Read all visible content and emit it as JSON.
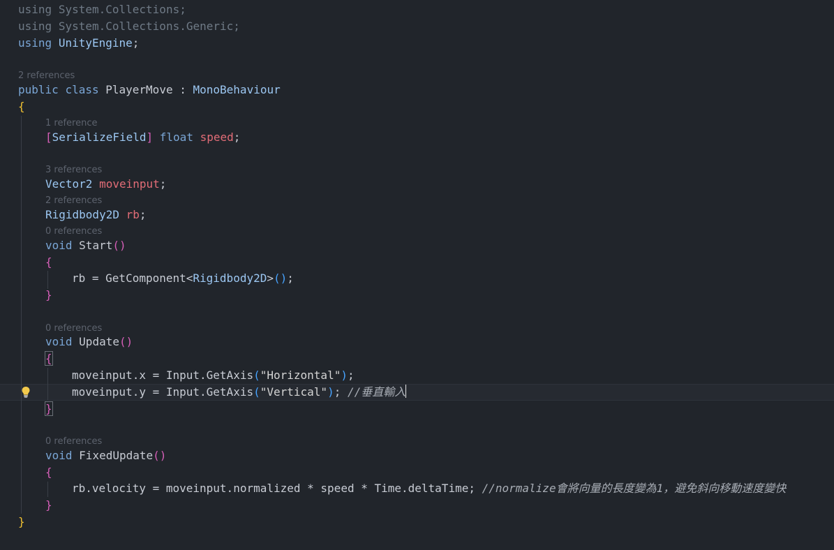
{
  "editor": {
    "usings": [
      {
        "kw": "using",
        "ns": "System.Collections",
        "end": ";"
      },
      {
        "kw": "using",
        "ns": "System.Collections.Generic",
        "end": ";"
      },
      {
        "kw": "using",
        "ns": "UnityEngine",
        "end": ";"
      }
    ],
    "class_refs": "2 references",
    "class_decl": {
      "mod": "public",
      "kw": "class",
      "name": "PlayerMove",
      "sep": ":",
      "base": "MonoBehaviour"
    },
    "open_brace": "{",
    "close_brace": "}",
    "speed": {
      "refs": "1 reference",
      "attr_open": "[",
      "attr": "SerializeField",
      "attr_close": "]",
      "type": "float",
      "name": "speed",
      "end": ";"
    },
    "moveinput_decl": {
      "refs": "3 references",
      "type": "Vector2",
      "name": "moveinput",
      "end": ";"
    },
    "rb_decl": {
      "refs": "2 references",
      "type": "Rigidbody2D",
      "name": "rb",
      "end": ";"
    },
    "start": {
      "refs": "0 references",
      "kw": "void",
      "name": "Start",
      "parens": "()",
      "open": "{",
      "close": "}",
      "body": {
        "lhs": "rb = GetComponent<",
        "generic": "Rigidbody2D",
        "rhs": ">",
        "call": "()",
        "end": ";"
      }
    },
    "update": {
      "refs": "0 references",
      "kw": "void",
      "name": "Update",
      "parens": "()",
      "open": "{",
      "close": "}",
      "line1": {
        "lhs": "moveinput.x = Input.GetAxis",
        "po": "(",
        "str": "\"Horizontal\"",
        "pc": ")",
        "end": ";"
      },
      "line2": {
        "lhs": "moveinput.y = Input.GetAxis",
        "po": "(",
        "str": "\"Vertical\"",
        "pc": ")",
        "end": "; ",
        "comment": "//垂直輸入"
      }
    },
    "fixed": {
      "refs": "0 references",
      "kw": "void",
      "name": "FixedUpdate",
      "parens": "()",
      "open": "{",
      "close": "}",
      "body": {
        "code": "rb.velocity = moveinput.normalized * speed * Time.deltaTime; ",
        "comment": "//normalize會將向量的長度變為1，避免斜向移動速度變快"
      }
    }
  },
  "colors": {
    "background": "#21252b",
    "keyword": "#7aa6d6",
    "field": "#e26d77",
    "brace_outer": "#f1c232",
    "brace_inner": "#d65fb8",
    "paren": "#47a3ff"
  },
  "icons": {
    "lightbulb": "lightbulb-icon"
  }
}
